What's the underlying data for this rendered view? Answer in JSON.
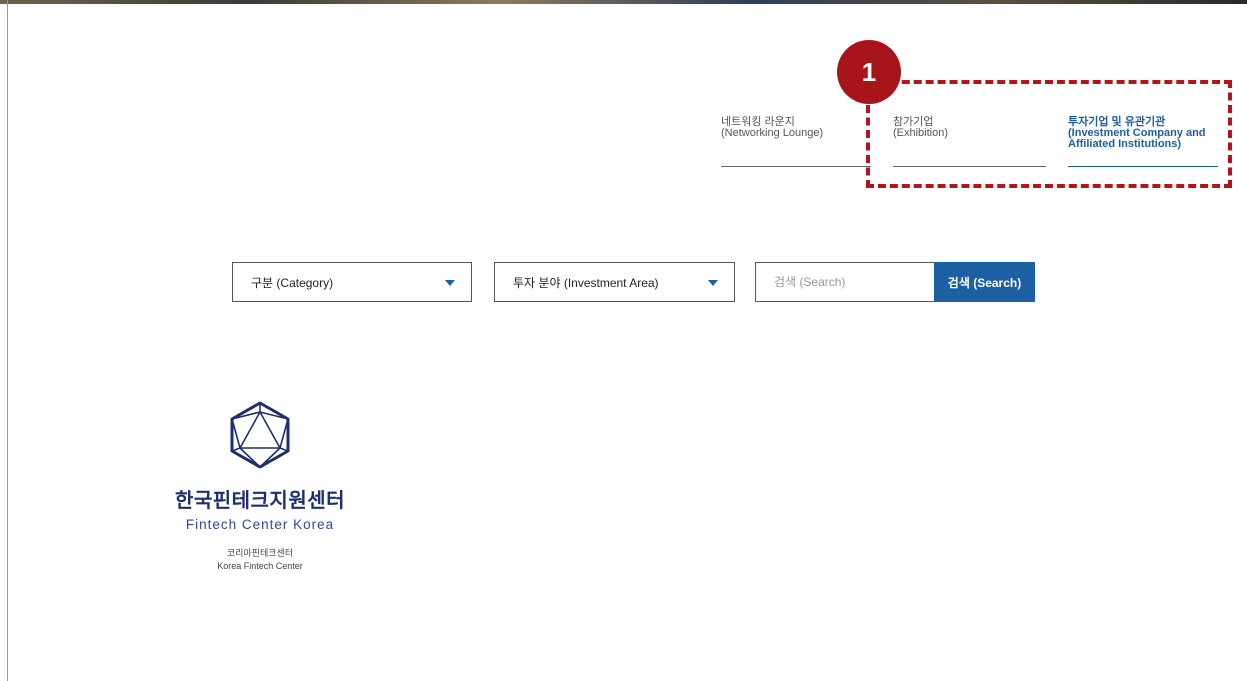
{
  "tabs": [
    {
      "label_ko": "네트워킹 라운지",
      "label_en": "(Networking Lounge)",
      "active": false
    },
    {
      "label_ko": "참가기업",
      "label_en": "(Exhibition)",
      "active": false
    },
    {
      "label_ko": "투자기업 및 유관기관",
      "label_en": "(Investment Company and Affiliated Institutions)",
      "active": true
    }
  ],
  "annotation": {
    "number": "1",
    "color": "#b3151e"
  },
  "filters": {
    "category_label": "구분 (Category)",
    "area_label": "투자 분야 (Investment Area)",
    "search_placeholder": "검색 (Search)",
    "search_button": "검색 (Search)"
  },
  "logo": {
    "name_ko": "한국핀테크지원센터",
    "name_en": "Fintech Center Korea",
    "sub_ko": "코리아핀테크센터",
    "sub_en": "Korea Fintech Center"
  },
  "colors": {
    "accent": "#1d5fa3",
    "brand": "#1f2f6e"
  }
}
